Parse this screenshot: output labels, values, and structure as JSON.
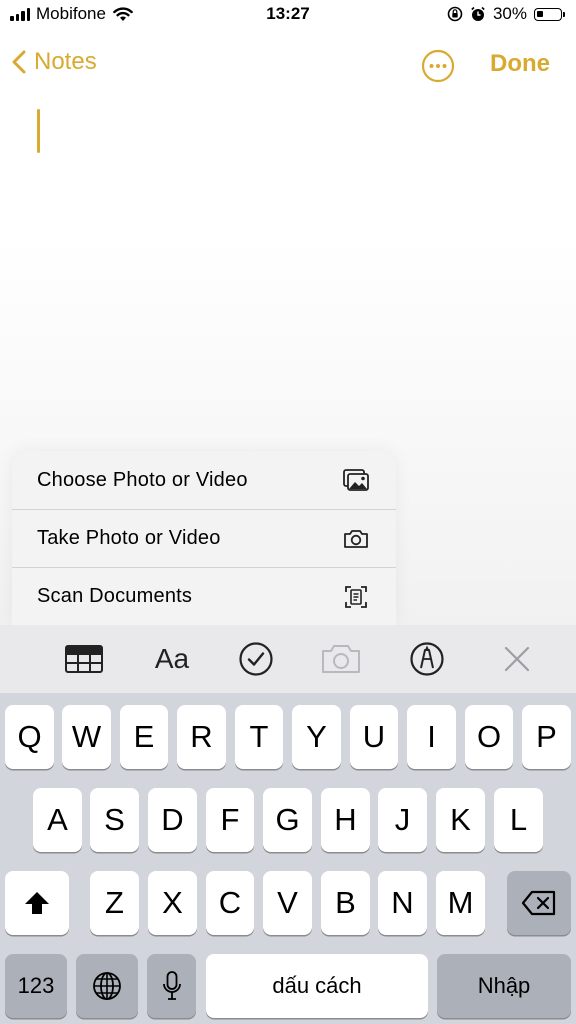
{
  "status_bar": {
    "carrier": "Mobifone",
    "time": "13:27",
    "battery_text": "30%",
    "battery_level": 0.3
  },
  "nav": {
    "back_label": "Notes",
    "done_label": "Done"
  },
  "menu": {
    "items": [
      {
        "label": "Choose Photo or Video",
        "icon": "photo-library-icon"
      },
      {
        "label": "Take Photo or Video",
        "icon": "camera-icon"
      },
      {
        "label": "Scan Documents",
        "icon": "scan-document-icon"
      }
    ]
  },
  "toolbar": {
    "format_label": "Aa",
    "items": [
      "table-icon",
      "format-text-icon",
      "checklist-icon",
      "camera-icon",
      "markup-pen-icon",
      "close-icon"
    ]
  },
  "keyboard": {
    "row1": [
      "Q",
      "W",
      "E",
      "R",
      "T",
      "Y",
      "U",
      "I",
      "O",
      "P"
    ],
    "row2": [
      "A",
      "S",
      "D",
      "F",
      "G",
      "H",
      "J",
      "K",
      "L"
    ],
    "row3": [
      "Z",
      "X",
      "C",
      "V",
      "B",
      "N",
      "M"
    ],
    "numbers_label": "123",
    "space_label": "dấu cách",
    "return_label": "Nhập"
  },
  "colors": {
    "accent": "#d9aa30",
    "keyboard_bg": "#d2d5db",
    "toolbar_bg": "#e9e9eb"
  }
}
